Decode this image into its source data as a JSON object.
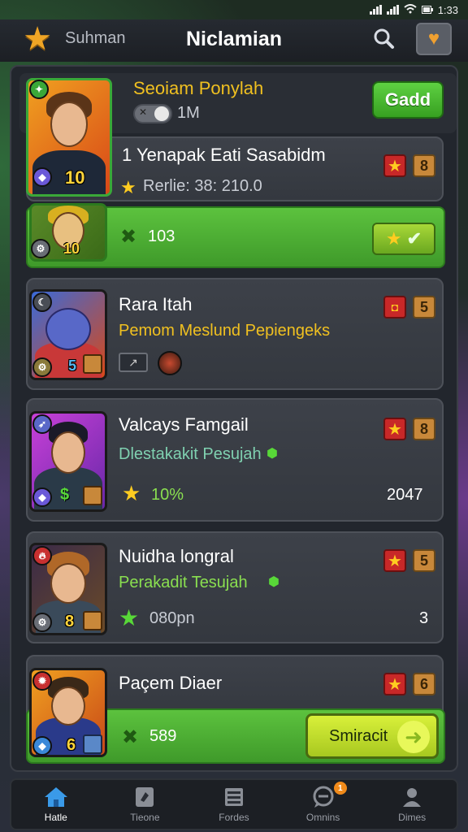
{
  "status_bar": {
    "time": "1:33"
  },
  "header": {
    "logo_text": "Suhman",
    "title": "Niclamian",
    "logo_icon": "star-icon",
    "search_icon": "search-icon",
    "heart_icon": "heart-icon"
  },
  "featured": {
    "name": "Seoiam Ponylah",
    "toggle_label": "1M",
    "button_label": "Gadd",
    "level": "10"
  },
  "entries": [
    {
      "name": "1 Yenapak Eati Sasabidm",
      "subtitle": "Rerlie: 38: 210.0",
      "badge_num": "8",
      "stat": "103"
    },
    {
      "name": "Rara Itah",
      "subtitle": "Pemom Meslund Pepiengeks",
      "badge_num": "5",
      "level": "5"
    },
    {
      "name": "Valcays Famgail",
      "subtitle": "Dlestakakit Pesujah",
      "badge_num": "8",
      "stat": "10%",
      "value": "2047"
    },
    {
      "name": "Nuidha longral",
      "subtitle": "Perakadit Tesujah",
      "badge_num": "5",
      "stat": "080pn",
      "value": "3",
      "level": "8"
    },
    {
      "name": "Paçem Diaer",
      "badge_num": "6",
      "stat": "589",
      "button_label": "Smiracit",
      "level": "6"
    }
  ],
  "nav": [
    {
      "label": "Hatle",
      "icon": "home-icon"
    },
    {
      "label": "Tieone",
      "icon": "card-icon"
    },
    {
      "label": "Fordes",
      "icon": "list-icon"
    },
    {
      "label": "Omnins",
      "icon": "chat-icon",
      "badge": "1"
    },
    {
      "label": "Dimes",
      "icon": "profile-icon"
    }
  ],
  "colors": {
    "accent_green": "#4fb833",
    "star_red": "#c82828",
    "badge_orange": "#c8883a"
  }
}
